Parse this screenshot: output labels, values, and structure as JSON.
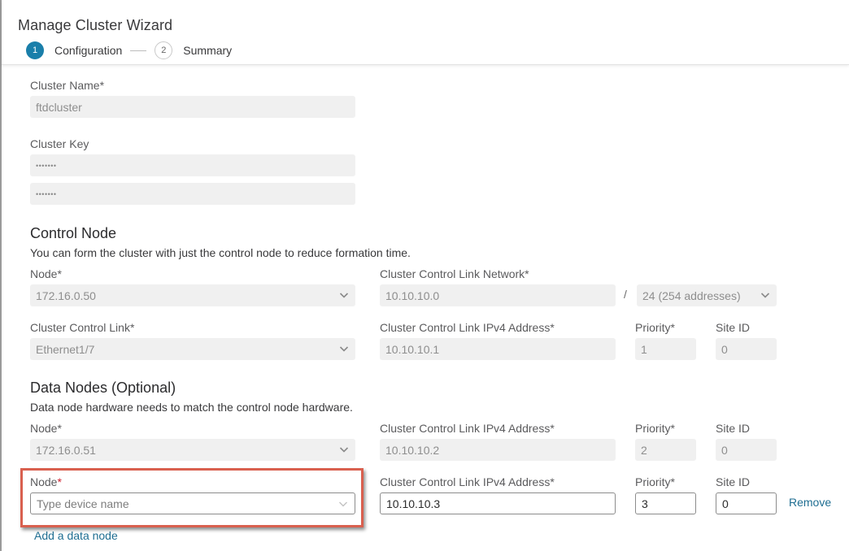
{
  "wizard": {
    "title": "Manage Cluster Wizard",
    "steps": [
      {
        "number": "1",
        "label": "Configuration",
        "state": "active"
      },
      {
        "number": "2",
        "label": "Summary",
        "state": "inactive"
      }
    ]
  },
  "cluster": {
    "name_label": "Cluster Name*",
    "name_value": "ftdcluster",
    "key_label": "Cluster Key",
    "key_value": "•••••••",
    "key_confirm_value": "•••••••"
  },
  "control_node": {
    "heading": "Control Node",
    "description": "You can form the cluster with just the control node to reduce formation time.",
    "node_label": "Node*",
    "node_value": "172.16.0.50",
    "ccl_network_label": "Cluster Control Link Network*",
    "ccl_network_value": "10.10.10.0",
    "slash": "/",
    "netmask_value": "24 (254 addresses)",
    "ccl_label": "Cluster Control Link*",
    "ccl_value": "Ethernet1/7",
    "ccl_ipv4_label": "Cluster Control Link IPv4 Address*",
    "ccl_ipv4_value": "10.10.10.1",
    "priority_label": "Priority*",
    "priority_value": "1",
    "site_id_label": "Site ID",
    "site_id_value": "0"
  },
  "data_nodes": {
    "heading": "Data Nodes (Optional)",
    "description": "Data node hardware needs to match the control node hardware.",
    "rows": [
      {
        "node_label": "Node*",
        "node_value": "172.16.0.51",
        "ccl_ipv4_label": "Cluster Control Link IPv4 Address*",
        "ccl_ipv4_value": "10.10.10.2",
        "priority_label": "Priority*",
        "priority_value": "2",
        "site_id_label": "Site ID",
        "site_id_value": "0"
      },
      {
        "node_label": "Node",
        "node_required_mark": "*",
        "node_placeholder": "Type device name",
        "ccl_ipv4_label": "Cluster Control Link IPv4 Address*",
        "ccl_ipv4_value": "10.10.10.3",
        "priority_label": "Priority*",
        "priority_value": "3",
        "site_id_label": "Site ID",
        "site_id_value": "0",
        "remove_label": "Remove"
      }
    ],
    "add_label": "Add a data node"
  },
  "colors": {
    "accent": "#1a7faa",
    "link": "#1f6e92",
    "highlight": "#d9604f",
    "required": "#cf2030"
  }
}
